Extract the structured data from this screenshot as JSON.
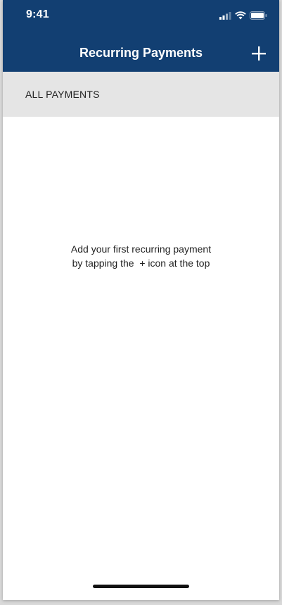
{
  "status_bar": {
    "time": "9:41",
    "icons": [
      "cellular-signal-icon",
      "wifi-icon",
      "battery-icon"
    ]
  },
  "nav": {
    "title": "Recurring Payments",
    "add_icon": "plus-icon"
  },
  "section": {
    "label": "ALL PAYMENTS"
  },
  "empty_state": {
    "line1": "Add your first recurring payment",
    "line2": "by tapping the  + icon at the top"
  },
  "colors": {
    "header_bg": "#123f72",
    "section_bg": "#e5e5e5",
    "text": "#1f1f1f"
  }
}
